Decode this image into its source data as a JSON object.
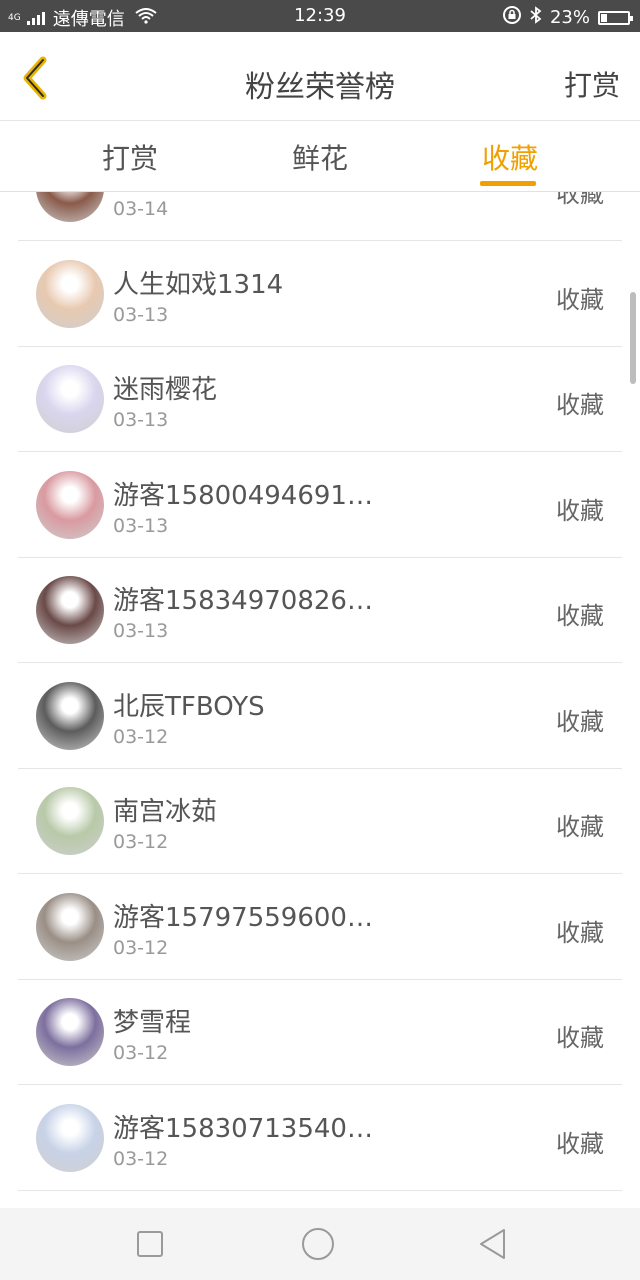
{
  "status_bar": {
    "network": "4G",
    "carrier": "遠傳電信",
    "time": "12:39",
    "battery": "23%",
    "battery_level": 0.23
  },
  "header": {
    "title": "粉丝荣誉榜",
    "right_label": "打赏",
    "back_icon": "chevron-left-icon",
    "accent_color": "#f0a000"
  },
  "tabs": [
    {
      "label": "打赏",
      "active": false
    },
    {
      "label": "鲜花",
      "active": false
    },
    {
      "label": "收藏",
      "active": true
    }
  ],
  "list": [
    {
      "name": "",
      "date": "03-14",
      "action": "收藏",
      "avatar_color": "#8a5a4a"
    },
    {
      "name": "人生如戏1314",
      "date": "03-13",
      "action": "收藏",
      "avatar_color": "#e8c9b0"
    },
    {
      "name": "迷雨樱花",
      "date": "03-13",
      "action": "收藏",
      "avatar_color": "#d9d6ee"
    },
    {
      "name": "游客15800494691…",
      "date": "03-13",
      "action": "收藏",
      "avatar_color": "#d99aa0"
    },
    {
      "name": "游客15834970826…",
      "date": "03-13",
      "action": "收藏",
      "avatar_color": "#6a4a48"
    },
    {
      "name": "北辰TFBOYS",
      "date": "03-12",
      "action": "收藏",
      "avatar_color": "#5c5c5c"
    },
    {
      "name": "南宫冰茹",
      "date": "03-12",
      "action": "收藏",
      "avatar_color": "#b8c9a8"
    },
    {
      "name": "游客15797559600…",
      "date": "03-12",
      "action": "收藏",
      "avatar_color": "#9a8f86"
    },
    {
      "name": "梦雪程",
      "date": "03-12",
      "action": "收藏",
      "avatar_color": "#7d6f9e"
    },
    {
      "name": "游客15830713540…",
      "date": "03-12",
      "action": "收藏",
      "avatar_color": "#c8d3e8"
    }
  ],
  "navbar": {
    "square_icon": "recent-apps-icon",
    "circle_icon": "home-icon",
    "triangle_icon": "back-triangle-icon"
  }
}
